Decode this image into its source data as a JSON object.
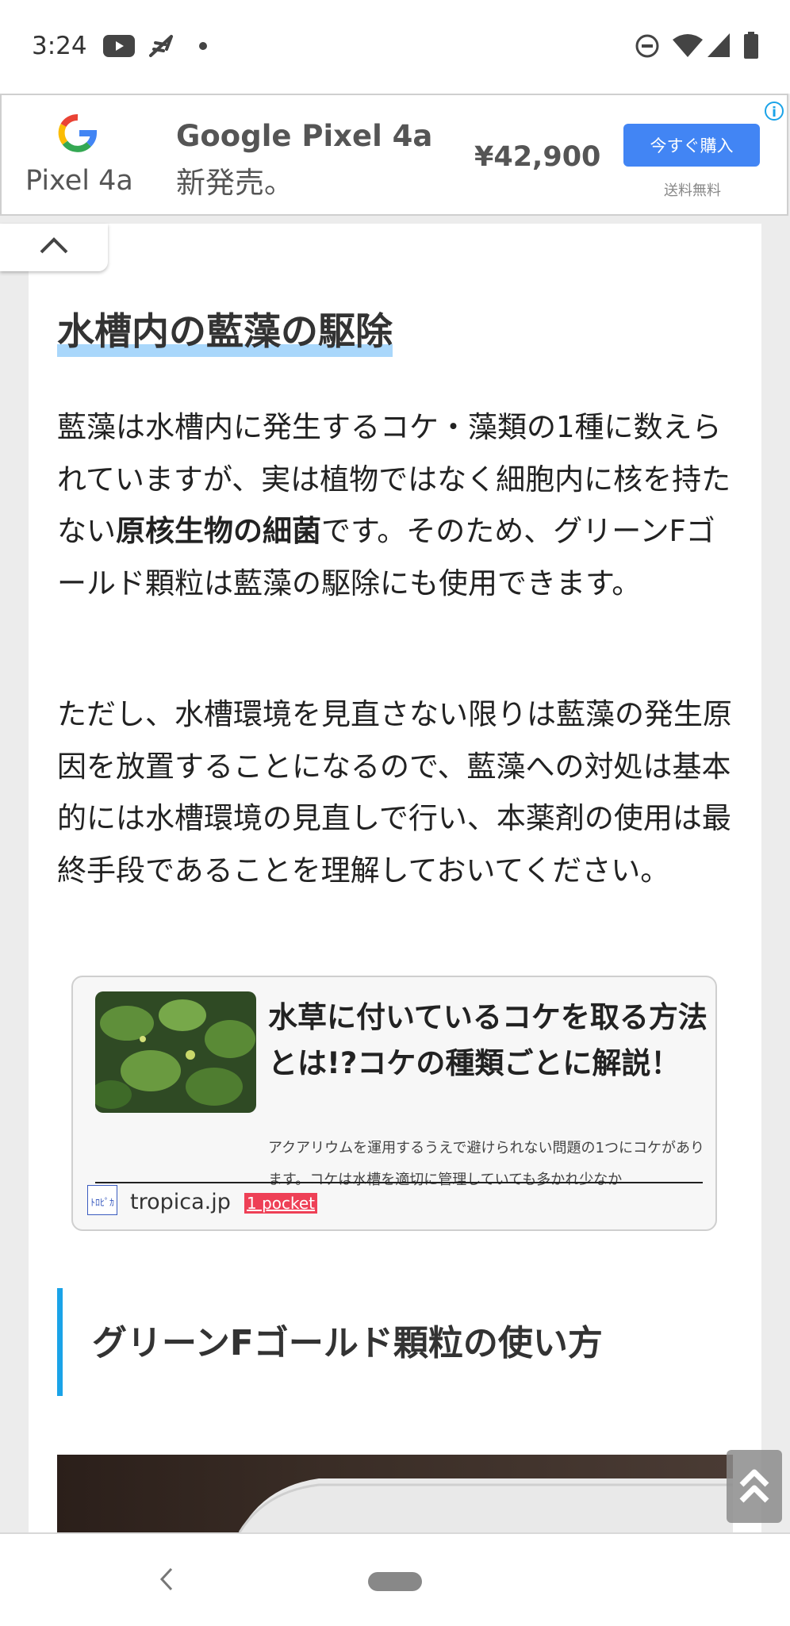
{
  "status_bar": {
    "time": "3:24",
    "left_icons": [
      "youtube-icon",
      "feather-icon",
      "dot-icon"
    ],
    "right_icons": [
      "do-not-disturb-icon",
      "wifi-icon",
      "signal-icon",
      "battery-icon"
    ]
  },
  "ad": {
    "logo_text": "Pixel 4a",
    "headline": "Google Pixel 4a",
    "subline": "新発売。",
    "price": "¥42,900",
    "buy_label": "今すぐ購入",
    "shipping": "送料無料",
    "info_label": "i",
    "colors": {
      "button": "#4285f4",
      "info": "#1aa3e8"
    }
  },
  "article": {
    "heading1": "水槽内の藍藻の駆除",
    "para1_part1": "藍藻は水槽内に発生するコケ・藻類の1種に数えられていますが、実は植物ではなく細胞内に核を持たない",
    "para1_bold": "原核生物の細菌",
    "para1_part2": "です。そのため、グリーンFゴールド顆粒は藍藻の駆除にも使用できます。",
    "para2": "ただし、水槽環境を見直さない限りは藍藻の発生原因を放置することになるので、藍藻への対処は基本的には水槽環境の見直しで行い、本薬剤の使用は最終手段であることを理解しておいてください。",
    "heading2": "グリーンFゴールド顆粒の使い方",
    "heading2_accent": "#1aa3e8"
  },
  "blogcard": {
    "title": "水草に付いているコケを取る方法とは!?コケの種類ごとに解説！",
    "excerpt": "アクアリウムを運用するうえで避けられない問題の1つにコケがあります。コケは水槽を適切に管理していても多かれ少なか",
    "site": "tropica.jp",
    "pocket": "1 pocket",
    "favicon_text": "ﾄﾛﾋﾟｶ"
  }
}
